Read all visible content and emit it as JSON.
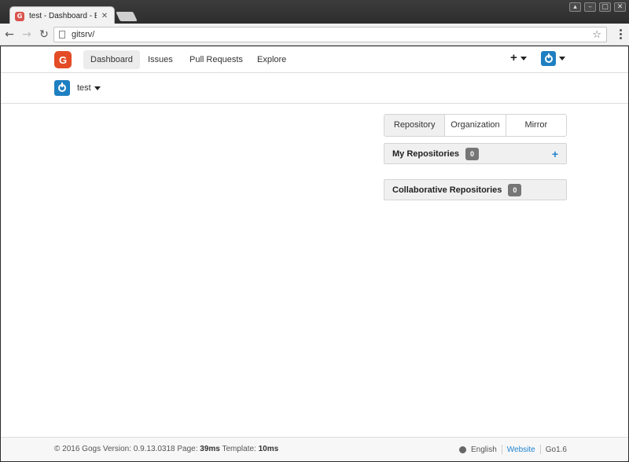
{
  "browser": {
    "tab_title": "test - Dashboard - Eeni",
    "tab_favicon": "G",
    "tab_close": "✕",
    "url": "gitsrv/",
    "nav_back": "←",
    "nav_forward": "→",
    "nav_reload": "↻",
    "bookmark": "☆",
    "window_controls": [
      "▴",
      "–",
      "▢",
      "✕"
    ]
  },
  "header": {
    "logo": "G",
    "nav": [
      {
        "label": "Dashboard",
        "active": true
      },
      {
        "label": "Issues",
        "active": false
      },
      {
        "label": "Pull Requests",
        "active": false
      },
      {
        "label": "Explore",
        "active": false
      }
    ],
    "create_label": "+"
  },
  "context": {
    "user": "test"
  },
  "sidebar": {
    "tabs": [
      "Repository",
      "Organization",
      "Mirror"
    ],
    "my_repos": {
      "title": "My Repositories",
      "count": "0",
      "add": "+"
    },
    "collab_repos": {
      "title": "Collaborative Repositories",
      "count": "0"
    }
  },
  "footer": {
    "copyright": "© 2016 Gogs Version: 0.9.13.0318 Page: ",
    "page_time": "39ms",
    "template_label": " Template: ",
    "template_time": "10ms",
    "language": "English",
    "website": "Website",
    "go_version": "Go1.6"
  },
  "colors": {
    "accent": "#2185d0",
    "logo": "#e34c26",
    "avatar": "#1e7fc1"
  }
}
